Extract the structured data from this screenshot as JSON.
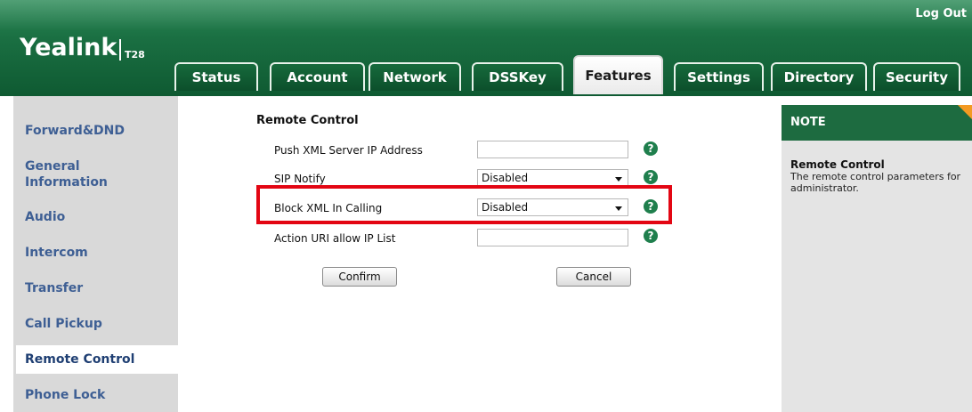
{
  "header": {
    "logo": "Yealink",
    "model": "T28",
    "logout": "Log Out"
  },
  "tabs": [
    {
      "label": "Status",
      "active": false
    },
    {
      "label": "Account",
      "active": false
    },
    {
      "label": "Network",
      "active": false
    },
    {
      "label": "DSSKey",
      "active": false
    },
    {
      "label": "Features",
      "active": true
    },
    {
      "label": "Settings",
      "active": false
    },
    {
      "label": "Directory",
      "active": false
    },
    {
      "label": "Security",
      "active": false
    }
  ],
  "sidebar": {
    "items": [
      {
        "label": "Forward&DND",
        "active": false
      },
      {
        "label": "General\nInformation",
        "active": false
      },
      {
        "label": "Audio",
        "active": false
      },
      {
        "label": "Intercom",
        "active": false
      },
      {
        "label": "Transfer",
        "active": false
      },
      {
        "label": "Call Pickup",
        "active": false
      },
      {
        "label": "Remote Control",
        "active": true
      },
      {
        "label": "Phone Lock",
        "active": false
      }
    ]
  },
  "main": {
    "section_title": "Remote Control",
    "rows": [
      {
        "label": "Push XML Server IP Address",
        "type": "input",
        "value": "",
        "help": "?"
      },
      {
        "label": "SIP Notify",
        "type": "select",
        "value": "Disabled",
        "help": "?"
      },
      {
        "label": "Block XML In Calling",
        "type": "select",
        "value": "Disabled",
        "help": "?"
      },
      {
        "label": "Action URI allow IP List",
        "type": "input",
        "value": "",
        "help": "?"
      }
    ],
    "confirm_label": "Confirm",
    "cancel_label": "Cancel"
  },
  "note": {
    "heading": "NOTE",
    "title": "Remote Control",
    "text": "The remote control parameters for administrator."
  },
  "colors": {
    "header_green": "#1a6f42",
    "nav_text": "#3e5f94",
    "highlight_red": "#e30613",
    "help_green": "#1f7f4d",
    "note_corner": "#f39a22"
  },
  "icons": {
    "help": "question-circle-icon",
    "dropdown": "chevron-down-icon",
    "note_corner": "corner-fold-icon"
  }
}
